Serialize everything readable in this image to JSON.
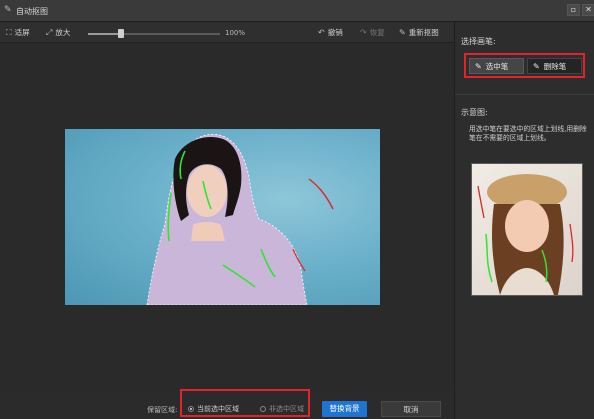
{
  "window": {
    "title": "自动抠图",
    "max_icon": "maximize-icon",
    "close_icon": "close-icon"
  },
  "toolbar": {
    "fit_label": "适屏",
    "zoom_in_label": "放大",
    "zoom_value": "100%",
    "zoom_level": 0.25,
    "undo_label": "撤销",
    "redo_label": "恢复",
    "redo_cut_label": "重新抠图"
  },
  "right_panel": {
    "choose_pen_label": "选择画笔:",
    "select_pen_label": "选中笔",
    "erase_pen_label": "删除笔",
    "example_label": "示意图:",
    "hint_text": "用选中笔在要选中的区域上划线,用删除笔在不需要的区域上划线。"
  },
  "bottom": {
    "keep_area_label": "保留区域:",
    "option_current": "当前选中区域",
    "option_other": "非选中区域",
    "selected_option": "当前选中区域",
    "replace_bg_label": "替换背景",
    "cancel_label": "取消"
  },
  "colors": {
    "accent_red": "#e0242a",
    "primary_blue": "#1e74d0",
    "stroke_green": "#2ee62e",
    "stroke_red": "#e0242a"
  }
}
